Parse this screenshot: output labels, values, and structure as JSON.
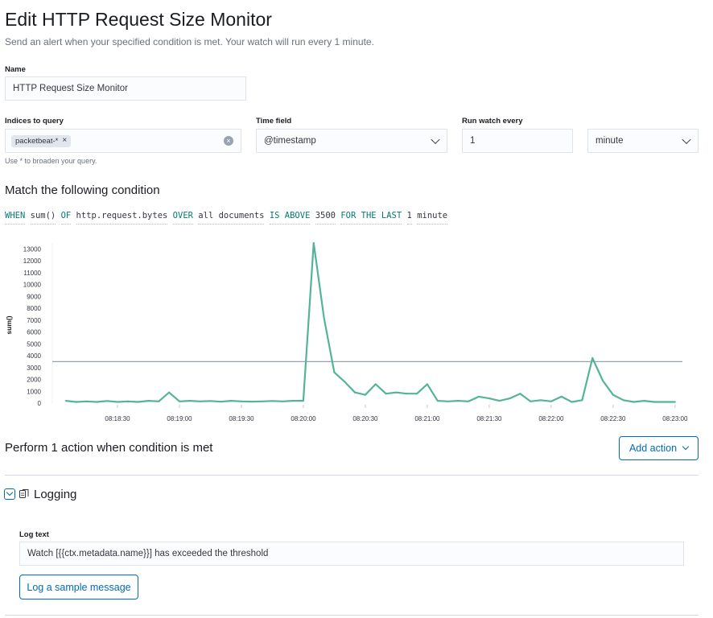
{
  "page": {
    "title": "Edit HTTP Request Size Monitor",
    "subtitle": "Send an alert when your specified condition is met. Your watch will run every 1 minute."
  },
  "form": {
    "name_label": "Name",
    "name_value": "HTTP Request Size Monitor",
    "indices_label": "Indices to query",
    "indices_tag": "packetbeat-*",
    "indices_help": "Use * to broaden your query.",
    "time_field_label": "Time field",
    "time_field_value": "@timestamp",
    "run_every_label": "Run watch every",
    "run_every_value": "1",
    "run_every_unit": "minute"
  },
  "condition": {
    "heading": "Match the following condition",
    "when": "WHEN",
    "agg": "sum()",
    "of": "OF",
    "field": "http.request.bytes",
    "over": "OVER",
    "scope": "all documents",
    "is_above": "IS ABOVE",
    "threshold": "3500",
    "for_the_last": "FOR THE LAST",
    "window_size": "1",
    "window_unit": "minute"
  },
  "chart_data": {
    "type": "line",
    "ylabel": "sum()",
    "xlabel": "",
    "ylim": [
      0,
      13500
    ],
    "yticks": [
      0,
      1000,
      2000,
      3000,
      4000,
      5000,
      6000,
      7000,
      8000,
      9000,
      10000,
      11000,
      12000,
      13000
    ],
    "x_ticks": [
      "08:18:30",
      "08:19:00",
      "08:19:30",
      "08:20:00",
      "08:20:30",
      "08:21:00",
      "08:21:30",
      "08:22:00",
      "08:22:30",
      "08:23:00"
    ],
    "threshold": 3500,
    "line_color": "#54b399",
    "threshold_color": "#98a2b3",
    "series": [
      {
        "x": [
          "08:18:05",
          "08:18:10",
          "08:18:15",
          "08:18:20",
          "08:18:25",
          "08:18:30",
          "08:18:35",
          "08:18:40",
          "08:18:45",
          "08:18:50",
          "08:18:55",
          "08:19:00",
          "08:19:05",
          "08:19:10",
          "08:19:15",
          "08:19:20",
          "08:19:25",
          "08:19:30",
          "08:19:35",
          "08:19:40",
          "08:19:45",
          "08:19:50",
          "08:19:55",
          "08:20:00",
          "08:20:05",
          "08:20:10",
          "08:20:15",
          "08:20:20",
          "08:20:25",
          "08:20:30",
          "08:20:35",
          "08:20:40",
          "08:20:45",
          "08:20:50",
          "08:20:55",
          "08:21:00",
          "08:21:05",
          "08:21:10",
          "08:21:15",
          "08:21:20",
          "08:21:25",
          "08:21:30",
          "08:21:35",
          "08:21:40",
          "08:21:45",
          "08:21:50",
          "08:21:55",
          "08:22:00",
          "08:22:05",
          "08:22:10",
          "08:22:15",
          "08:22:20",
          "08:22:25",
          "08:22:30",
          "08:22:35",
          "08:22:40",
          "08:22:45",
          "08:22:50",
          "08:22:55",
          "08:23:00"
        ],
        "values": [
          200,
          100,
          150,
          100,
          180,
          100,
          150,
          100,
          200,
          150,
          900,
          150,
          200,
          150,
          180,
          120,
          200,
          150,
          130,
          150,
          180,
          150,
          200,
          200,
          13500,
          7200,
          2600,
          1800,
          900,
          700,
          1600,
          800,
          900,
          800,
          800,
          1600,
          200,
          150,
          200,
          150,
          550,
          400,
          200,
          400,
          800,
          150,
          250,
          150,
          550,
          100,
          250,
          3800,
          1900,
          700,
          250,
          100,
          200,
          100,
          100,
          100
        ]
      }
    ]
  },
  "actions": {
    "heading": "Perform 1 action when condition is met",
    "add_action_label": "Add action",
    "logging_title": "Logging",
    "log_text_label": "Log text",
    "log_text_value": "Watch [{{ctx.metadata.name}}] has exceeded the threshold",
    "log_sample_label": "Log a sample message"
  }
}
